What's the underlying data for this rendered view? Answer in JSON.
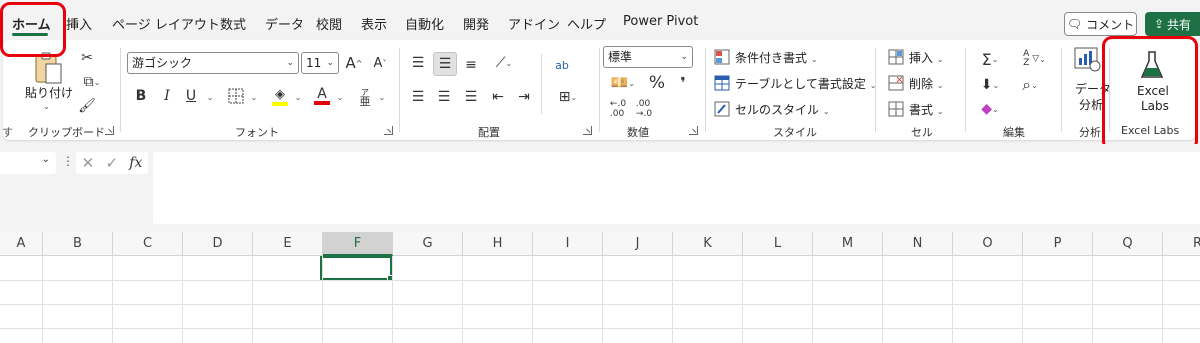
{
  "tabs": [
    "ホーム",
    "挿入",
    "ページ レイアウト",
    "数式",
    "データ",
    "校閲",
    "表示",
    "自動化",
    "開発",
    "アドイン",
    "ヘルプ",
    "Power Pivot"
  ],
  "header": {
    "comment_label": "コメント",
    "share_label": "共有"
  },
  "clipboard": {
    "paste_label": "貼り付け",
    "group_label": "クリップボード",
    "clipped_left_char": "す"
  },
  "font": {
    "name": "游ゴシック",
    "size": "11",
    "grow": "A",
    "shrink": "A",
    "bold": "B",
    "italic": "I",
    "underline": "U",
    "furigana_top": "ア",
    "furigana_bottom": "亜",
    "group_label": "フォント",
    "highlight_color": "#ffff00",
    "font_color": "#e00000"
  },
  "alignment": {
    "group_label": "配置",
    "wrap_label": "ab"
  },
  "number": {
    "format": "標準",
    "percent": "%",
    "comma": "❜",
    "group_label": "数値"
  },
  "styles": {
    "conditional": "条件付き書式",
    "table": "テーブルとして書式設定",
    "cell_styles": "セルのスタイル",
    "group_label": "スタイル"
  },
  "cells": {
    "insert": "挿入",
    "delete": "削除",
    "format": "書式",
    "group_label": "セル"
  },
  "editing": {
    "sum": "Σ",
    "sort": "A Z",
    "group_label": "編集"
  },
  "analysis": {
    "button_top": "データ",
    "button_bottom": "分析",
    "group_label": "分析"
  },
  "excel_labs": {
    "button_line1": "Excel",
    "button_line2": "Labs",
    "group_label": "Excel Labs"
  },
  "formula_bar": {
    "fx": "fx",
    "cancel": "✕",
    "enter": "✓",
    "value": ""
  },
  "grid": {
    "columns": [
      "A",
      "B",
      "C",
      "D",
      "E",
      "F",
      "G",
      "H",
      "I",
      "J",
      "K",
      "L",
      "M",
      "N",
      "O",
      "P",
      "Q",
      "R"
    ],
    "selected_column": "F"
  }
}
